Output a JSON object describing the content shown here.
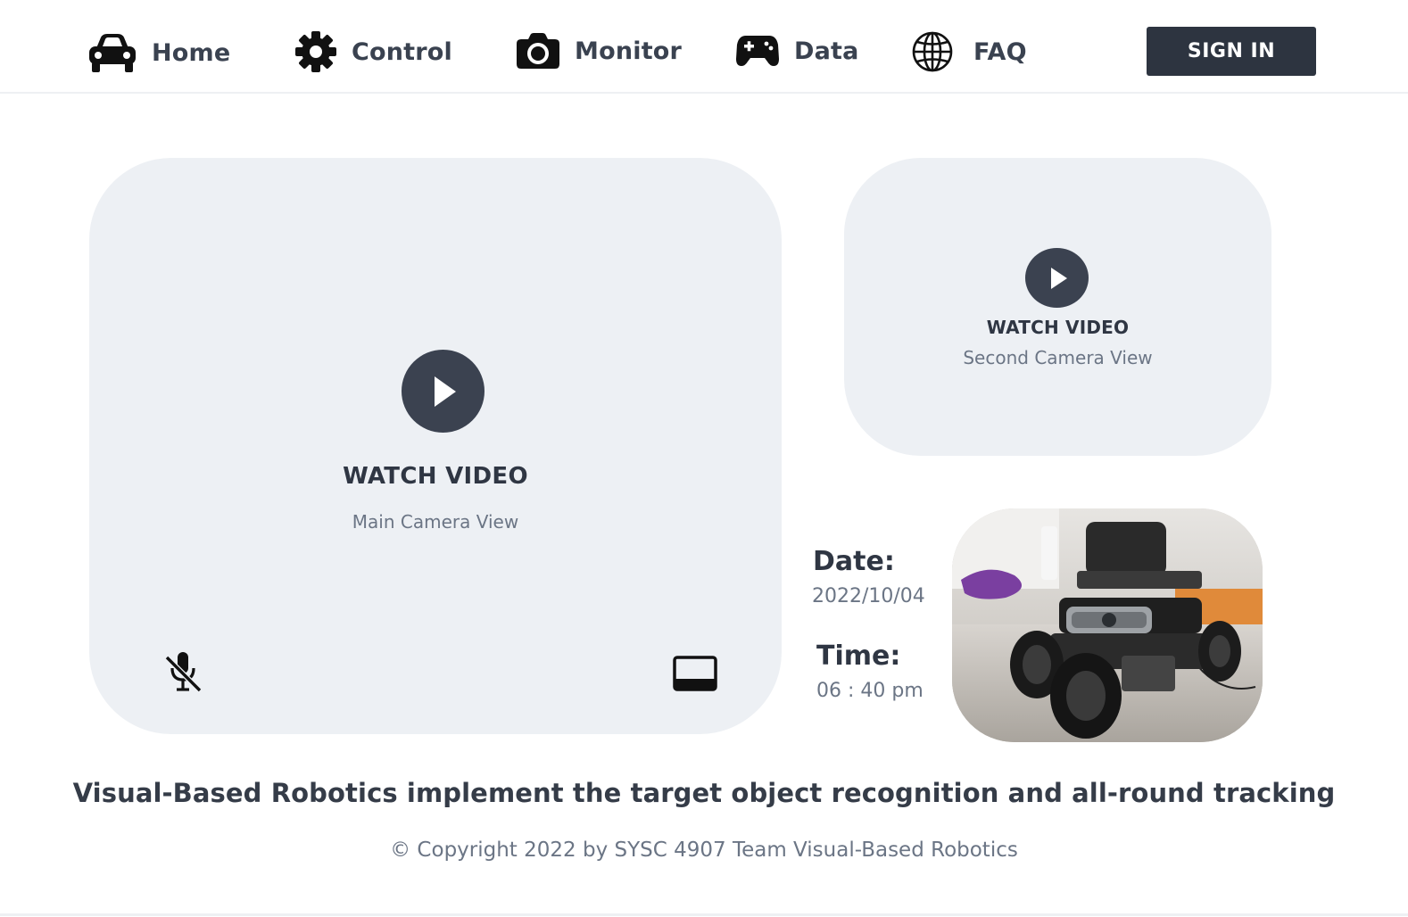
{
  "nav": {
    "items": [
      {
        "label": "Home",
        "icon": "car-icon"
      },
      {
        "label": "Control",
        "icon": "gear-icon"
      },
      {
        "label": "Monitor",
        "icon": "camera-icon"
      },
      {
        "label": "Data",
        "icon": "gamepad-icon"
      },
      {
        "label": "FAQ",
        "icon": "globe-icon"
      }
    ],
    "signin_label": "SIGN IN"
  },
  "main_video": {
    "watch_label": "WATCH VIDEO",
    "subtitle": "Main Camera View",
    "controls": [
      "mic-off-icon",
      "screen-icon"
    ]
  },
  "second_video": {
    "watch_label": "WATCH VIDEO",
    "subtitle": "Second Camera View"
  },
  "info": {
    "date_label": "Date:",
    "date_value": "2022/10/04",
    "time_label": "Time:",
    "time_value": "06 : 40 pm"
  },
  "footer": {
    "tagline": "Visual-Based Robotics implement the target object recognition and all-round tracking",
    "copyright": "© Copyright 2022 by SYSC 4907 Team Visual-Based Robotics"
  },
  "colors": {
    "primary_dark": "#2d3440",
    "panel_bg": "#edf0f4",
    "muted_text": "#6b7585"
  }
}
